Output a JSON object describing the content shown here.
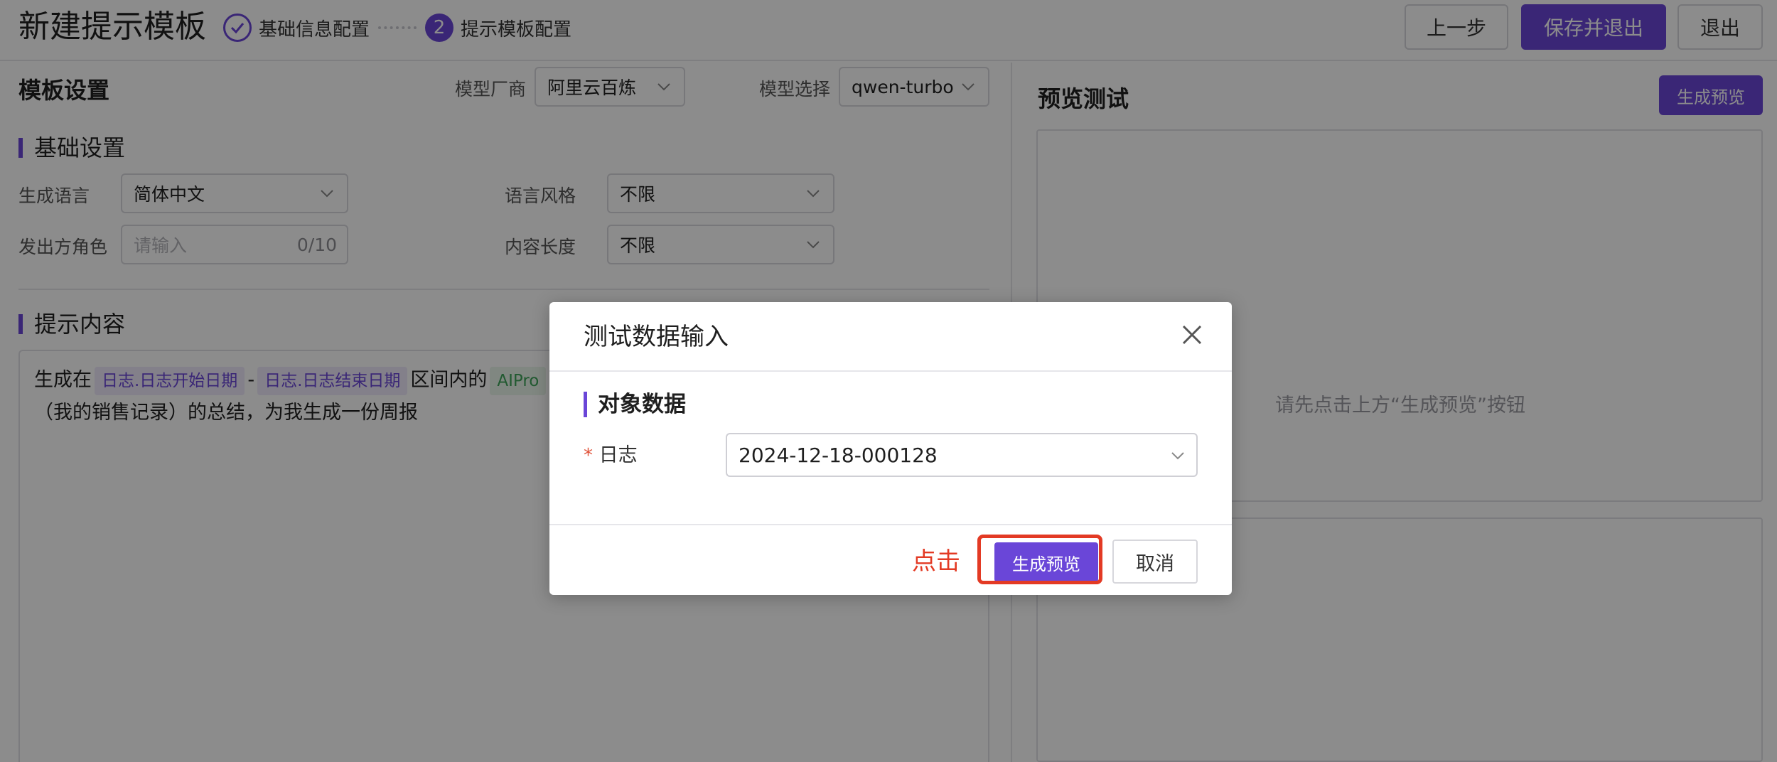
{
  "header": {
    "title": "新建提示模板",
    "steps": [
      {
        "number": "1",
        "label": "基础信息配置",
        "status": "done"
      },
      {
        "number": "2",
        "label": "提示模板配置",
        "status": "active"
      }
    ],
    "prev_label": "上一步",
    "save_exit_label": "保存并退出",
    "exit_label": "退出"
  },
  "template_settings": {
    "title": "模板设置",
    "vendor_label": "模型厂商",
    "vendor_value": "阿里云百炼",
    "model_label": "模型选择",
    "model_value": "qwen-turbo"
  },
  "basic_settings": {
    "title": "基础设置",
    "language_label": "生成语言",
    "language_value": "简体中文",
    "style_label": "语言风格",
    "style_value": "不限",
    "role_label": "发出方角色",
    "role_placeholder": "请输入",
    "role_count": "0/10",
    "length_label": "内容长度",
    "length_value": "不限"
  },
  "prompt": {
    "title": "提示内容",
    "text_1": "生成在",
    "tag_start": "日志.日志开始日期",
    "dash": "-",
    "tag_end": "日志.日志结束日期",
    "text_2": "区间内的",
    "tag_ai": "AIPro",
    "line_2": "（我的销售记录）的总结，为我生成一份周报"
  },
  "preview": {
    "title": "预览测试",
    "generate_label": "生成预览",
    "empty_text": "请先点击上方“生成预览”按钮"
  },
  "modal": {
    "title": "测试数据输入",
    "section_title": "对象数据",
    "required_mark": "*",
    "log_label": "日志",
    "log_value": "2024-12-18-000128",
    "click_hint": "点击",
    "generate_label": "生成预览",
    "cancel_label": "取消"
  },
  "colors": {
    "accent": "#6a46d8",
    "highlight": "#e33a24"
  }
}
